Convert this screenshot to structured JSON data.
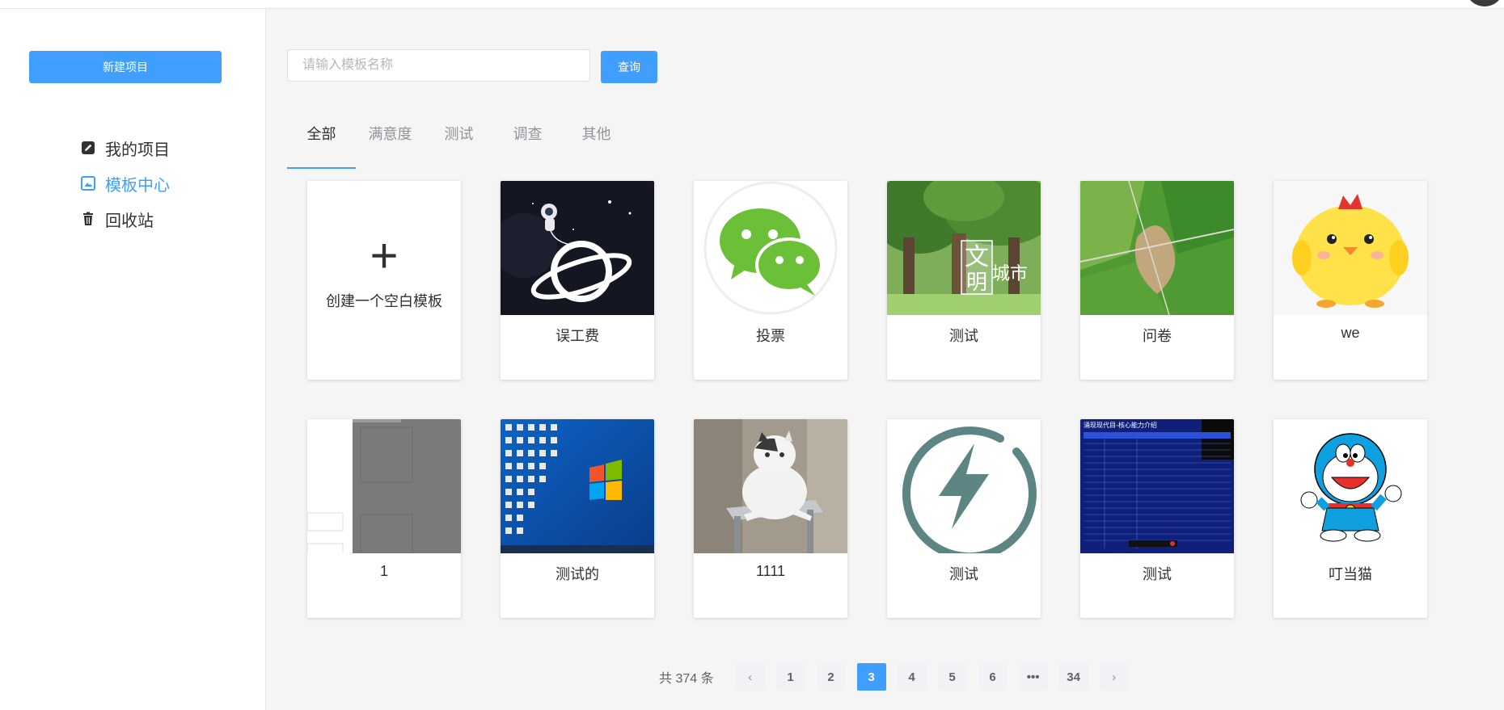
{
  "sidebar": {
    "new_project": "新建项目",
    "items": [
      {
        "label": "我的项目",
        "icon": "edit-icon"
      },
      {
        "label": "模板中心",
        "icon": "template-icon",
        "active": true
      },
      {
        "label": "回收站",
        "icon": "trash-icon"
      }
    ]
  },
  "search": {
    "placeholder": "请输入模板名称",
    "value": "",
    "button": "查询"
  },
  "tabs": [
    "全部",
    "满意度",
    "测试",
    "调查",
    "其他"
  ],
  "blank_card": {
    "label": "创建一个空白模板"
  },
  "templates": [
    {
      "label": "误工费",
      "thumb": "astronaut-planet"
    },
    {
      "label": "投票",
      "thumb": "wechat-logo"
    },
    {
      "label": "测试",
      "thumb": "civilized-city-trees"
    },
    {
      "label": "问卷",
      "thumb": "aerial-farmland"
    },
    {
      "label": "we",
      "thumb": "yellow-chick"
    },
    {
      "label": "1",
      "thumb": "gray-screenshot"
    },
    {
      "label": "测试的",
      "thumb": "windows-desktop"
    },
    {
      "label": "1111",
      "thumb": "white-cat"
    },
    {
      "label": "测试",
      "thumb": "lightning-icon"
    },
    {
      "label": "测试",
      "thumb": "blue-slide"
    },
    {
      "label": "叮当猫",
      "thumb": "doraemon"
    }
  ],
  "thumb_text": {
    "city_line1": "文",
    "city_line2": "明",
    "city_line3": "城市",
    "slide_title": "涌现现代目-核心能力介绍"
  },
  "pagination": {
    "total": "共 374 条",
    "pages": [
      "1",
      "2",
      "3",
      "4",
      "5",
      "6",
      "•••",
      "34"
    ],
    "current": "3",
    "prev": "‹",
    "next": "›"
  },
  "colors": {
    "accent": "#409eff",
    "sidebar_bg": "#ffffff",
    "main_bg": "#f5f5f5"
  }
}
